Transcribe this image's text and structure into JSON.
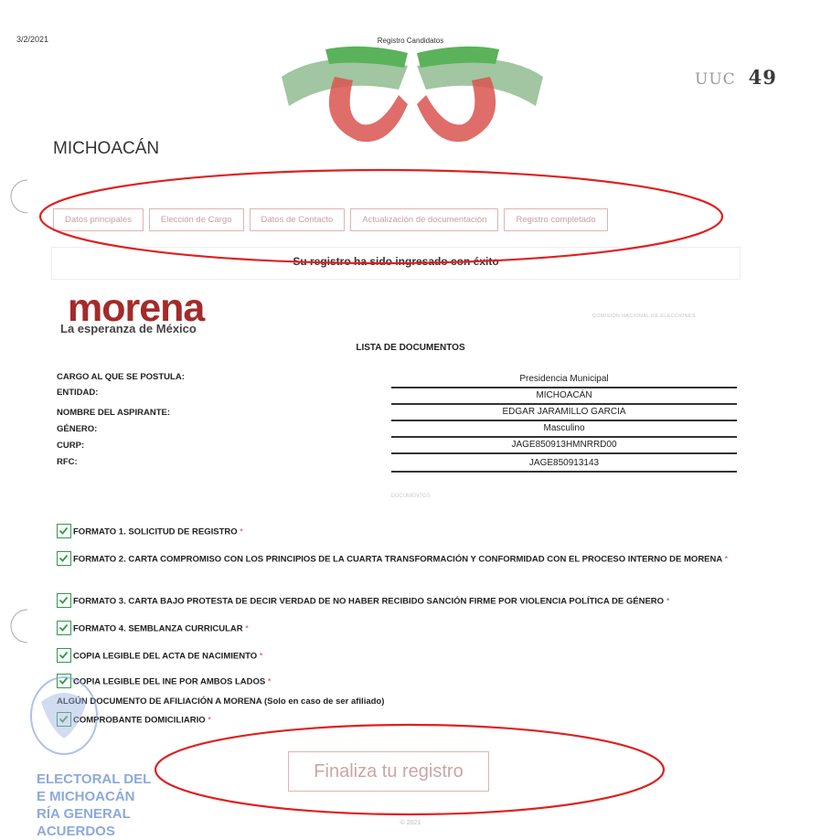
{
  "header": {
    "date": "3/2/2021",
    "title": "Registro Candidatos",
    "page_number_faint": "UUC",
    "page_number": "49"
  },
  "state_title": "MICHOACÁN",
  "tabs": [
    {
      "label": "Datos principales"
    },
    {
      "label": "Elección de Cargo"
    },
    {
      "label": "Datos de Contacto"
    },
    {
      "label": "Actualización de documentación"
    },
    {
      "label": "Registro completado"
    }
  ],
  "success_message": "Su registro ha sido ingresado con éxito",
  "logo": {
    "word": "morena",
    "tagline": "La esperanza de México"
  },
  "commission": "COMISIÓN NACIONAL DE ELECCIONES",
  "list_title": "LISTA DE DOCUMENTOS",
  "fields": [
    {
      "label": "CARGO AL QUE SE POSTULA:",
      "value": "Presidencia Municipal"
    },
    {
      "label": "ENTIDAD:",
      "value": "MICHOACÁN"
    },
    {
      "label": "NOMBRE DEL ASPIRANTE:",
      "value": "EDGAR JARAMILLO GARCIA"
    },
    {
      "label": "GÉNERO:",
      "value": "Masculino"
    },
    {
      "label": "CURP:",
      "value": "JAGE850913HMNRRD00"
    },
    {
      "label": "RFC:",
      "value": "JAGE850913143"
    }
  ],
  "docs_label": "DOCUMENTOS",
  "documents": [
    {
      "text": "FORMATO 1. SOLICITUD DE REGISTRO",
      "required": "*"
    },
    {
      "text": "FORMATO 2. CARTA COMPROMISO CON LOS PRINCIPIOS DE LA CUARTA TRANSFORMACIÓN Y CONFORMIDAD CON EL PROCESO INTERNO DE MORENA",
      "required": "*"
    },
    {
      "text": "FORMATO 3. CARTA BAJO PROTESTA DE DECIR VERDAD DE NO HABER RECIBIDO SANCIÓN FIRME POR VIOLENCIA POLÍTICA DE GÉNERO",
      "required": "*"
    },
    {
      "text": "FORMATO 4. SEMBLANZA CURRICULAR",
      "required": "*"
    },
    {
      "text": "COPIA LEGIBLE DEL ACTA DE NACIMIENTO",
      "required": "*"
    },
    {
      "text": "COPIA LEGIBLE DEL INE POR AMBOS LADOS",
      "required": "*"
    },
    {
      "text": "ALGÚN DOCUMENTO DE AFILIACIÓN A MORENA (Solo en caso de ser afiliado)",
      "required": ""
    },
    {
      "text": "COMPROBANTE DOMICILIARIO",
      "required": "*"
    }
  ],
  "finalize_button": "Finaliza tu registro",
  "footer": "© 2021",
  "stamp": {
    "line1": "ELECTORAL DEL",
    "line2": "E MICHOACÁN",
    "line3": "RÍA GENERAL",
    "line4": "ACUERDOS"
  },
  "colors": {
    "morena_red": "#a52a2a",
    "annotation_red": "#e02020",
    "check_green": "#2e9b4a",
    "tab_border": "#e3b2b2"
  }
}
